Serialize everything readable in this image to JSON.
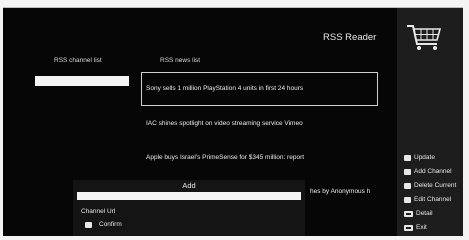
{
  "header": {
    "title": "RSS Reader",
    "cart_icon": "shopping-cart-icon"
  },
  "columns": {
    "channel_list": "RSS channel list",
    "news_list": "RSS news list"
  },
  "news": [
    "Sony sells 1 million PlayStation 4 units in first 24 hours",
    "IAC shines spotlight on video streaming service Vimeo",
    "Apple buys Israel's PrimeSense for $345 million: report",
    "hes by Anonymous h"
  ],
  "sidebar": {
    "items": [
      {
        "label": "Update",
        "icon": "white-square-icon"
      },
      {
        "label": "Add Channel",
        "icon": "white-square-icon"
      },
      {
        "label": "Delete Current",
        "icon": "white-square-icon"
      },
      {
        "label": "Edit Channel",
        "icon": "white-square-icon"
      },
      {
        "label": "Detail",
        "icon": "ok-key-icon"
      },
      {
        "label": "Exit",
        "icon": "exit-key-icon"
      }
    ]
  },
  "dialog": {
    "title": "Add",
    "input_value": "",
    "url_label": "Channel Url",
    "confirm_label": "Confirm"
  },
  "colors": {
    "background": "#060606",
    "panel": "#1d1d1d",
    "text": "#e6e6e6"
  }
}
